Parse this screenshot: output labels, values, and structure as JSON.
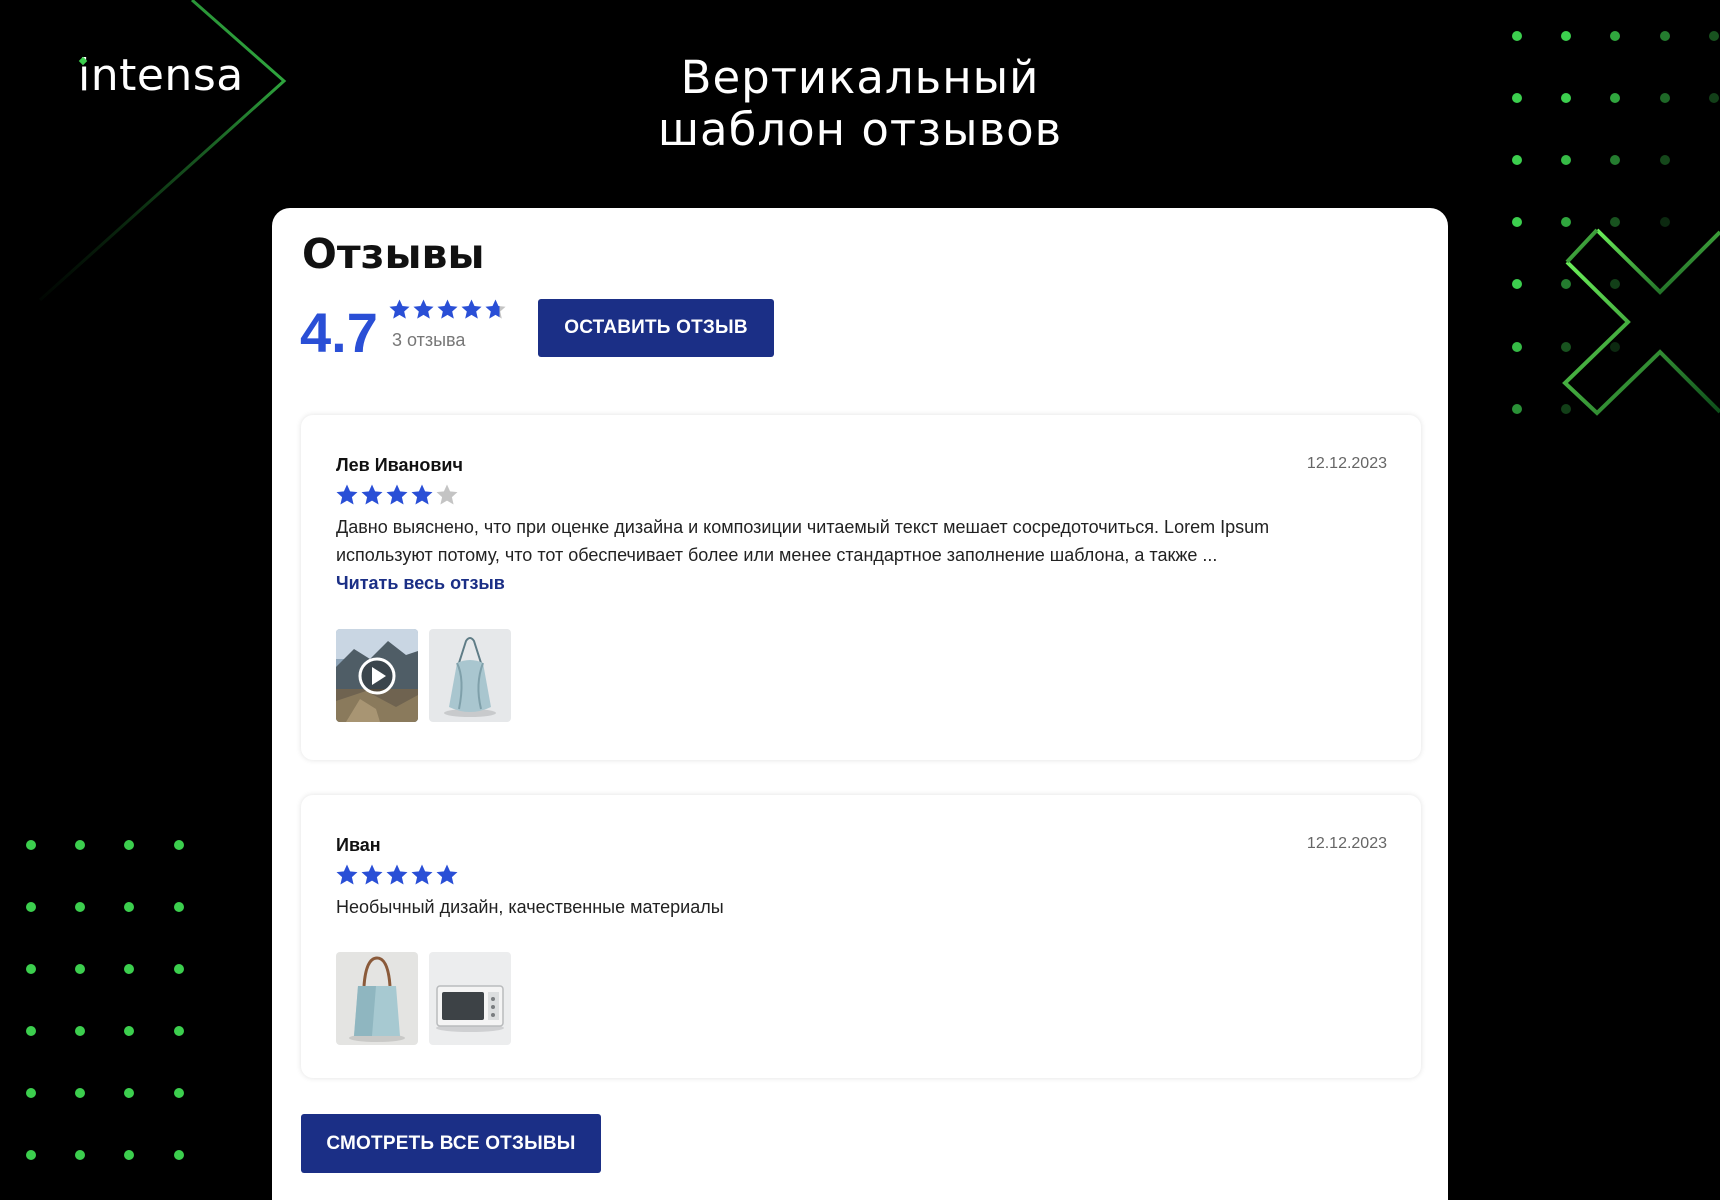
{
  "brand": {
    "name": "intensa"
  },
  "headline": {
    "line1": "Вертикальный",
    "line2": "шаблон отзывов"
  },
  "reviews_widget": {
    "title": "Отзывы",
    "average_rating": "4.7",
    "average_rating_value": 4.7,
    "reviews_count": "3 отзыва",
    "leave_review_label": "ОСТАВИТЬ ОТЗЫВ",
    "view_all_label": "СМОТРЕТЬ ВСЕ ОТЗЫВЫ",
    "items": [
      {
        "author": "Лев Иванович",
        "date": "12.12.2023",
        "rating": 4,
        "text_line1": "Давно выяснено, что при оценке дизайна и композиции читаемый текст мешает сосредоточиться. Lorem Ipsum",
        "text_line2": "используют потому, что тот обеспечивает более или менее стандартное заполнение шаблона, а также ...",
        "read_more": "Читать весь отзыв",
        "media": [
          "video-mountain",
          "photo-bag"
        ]
      },
      {
        "author": "Иван",
        "date": "12.12.2023",
        "rating": 5,
        "text_line1": "Необычный дизайн, качественные материалы",
        "media": [
          "photo-tote-bag",
          "photo-microwave"
        ]
      }
    ]
  },
  "colors": {
    "background": "#000000",
    "accent_green": "#3ccf4e",
    "star_blue": "#2a4fd6",
    "star_empty": "#c4c4c4",
    "button_blue": "#1b2f86"
  }
}
